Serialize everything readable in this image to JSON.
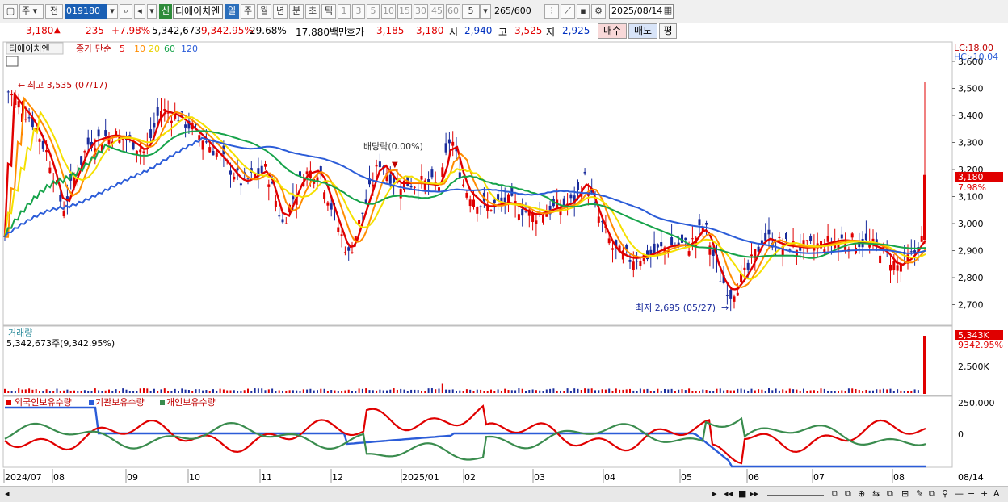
{
  "toolbar": {
    "screen_icon": "window-icon",
    "period_select": "주",
    "prev_label": "전",
    "code": "019180",
    "market_badge": "신",
    "stock_name": "티에이치엔",
    "periods": [
      "일",
      "주",
      "월",
      "년",
      "분",
      "초",
      "틱"
    ],
    "active_period": "일",
    "intervals": [
      "1",
      "3",
      "5",
      "10",
      "15",
      "30",
      "45",
      "60"
    ],
    "interval_value": "5",
    "count": "265/600",
    "date": "2025/08/14"
  },
  "quote": {
    "price": "3,180",
    "change": "235",
    "change_rate": "+7.98%",
    "volume": "5,342,673",
    "volume_rate": "9,342.95%",
    "turnover": "29.68%",
    "amount": "17,880백만",
    "bid_label": "호가",
    "bid": "3,185",
    "ask": "3,180",
    "open_label": "시",
    "open": "2,940",
    "high_label": "고",
    "high": "3,525",
    "low_label": "저",
    "low": "2,925",
    "buy_label": "매수",
    "sell_label": "매도",
    "eval_label": "평"
  },
  "main_panel": {
    "legend_name": "티에이치엔",
    "legend_ma": "종가 단순",
    "ma_periods": [
      "5",
      "10",
      "20",
      "60",
      "120"
    ],
    "ma_colors": [
      "#e00000",
      "#ff8c00",
      "#f5e000",
      "#16a34a",
      "#2b5cd8"
    ],
    "lc_label": "LC:18.00",
    "hc_label": "HC:-10.04",
    "high_annot": "최고 3,535 (07/17)",
    "low_annot": "최저 2,695 (05/27)",
    "dividend_annot": "배당락(0.00%)",
    "price_ticks": [
      "3,600",
      "3,500",
      "3,400",
      "3,300",
      "3,200",
      "3,100",
      "3,000",
      "2,900",
      "2,800",
      "2,700"
    ],
    "last_price_label": "3,180",
    "last_pct_label": "7.98%"
  },
  "volume_panel": {
    "title": "거래량",
    "value": "5,342,673주(9,342.95%)",
    "tick": "2,500K",
    "last_label": "5,343K",
    "last_pct": "9342.95%"
  },
  "holding_panel": {
    "series": [
      "외국인보유수량",
      "기관보유수량",
      "개인보유수량"
    ],
    "series_colors": [
      "#e00000",
      "#2b5cd8",
      "#3a8c4e"
    ],
    "ticks": [
      "250,000",
      "0"
    ]
  },
  "x_axis": {
    "labels": [
      "2024/07",
      "08",
      "09",
      "10",
      "11",
      "12",
      "2025/01",
      "02",
      "03",
      "04",
      "05",
      "06",
      "07",
      "08"
    ],
    "right_label": "08/14"
  }
}
